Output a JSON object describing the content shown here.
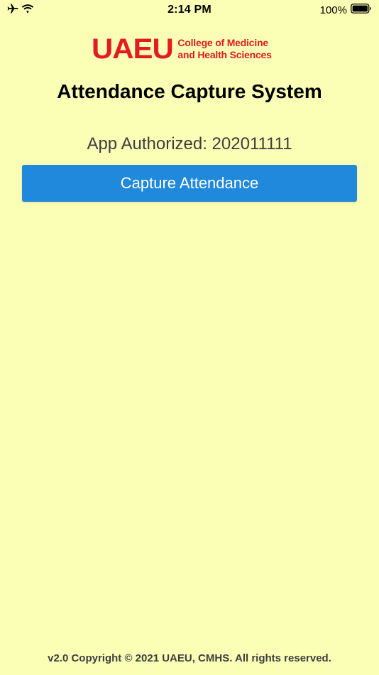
{
  "status_bar": {
    "time": "2:14 PM",
    "battery_percent": "100%",
    "icons": [
      "airplane-icon",
      "wifi-icon",
      "battery-icon"
    ]
  },
  "logo": {
    "mark": "UAEU",
    "line1": "College of Medicine",
    "line2": "and Health Sciences",
    "color": "#e31b23"
  },
  "header": {
    "title": "Attendance Capture System"
  },
  "authorization": {
    "text": "App Authorized: 202011111"
  },
  "actions": {
    "capture_label": "Capture Attendance",
    "button_color": "#2089dc"
  },
  "footer": {
    "copyright": "v2.0 Copyright © 2021 UAEU, CMHS. All rights reserved."
  },
  "theme": {
    "background": "#fbffb5"
  }
}
